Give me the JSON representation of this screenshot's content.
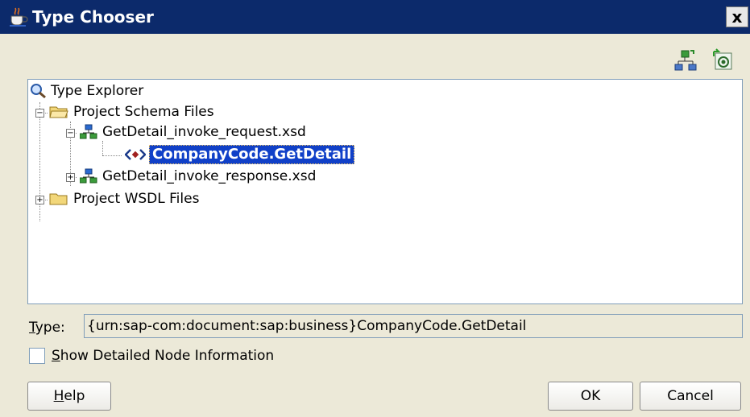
{
  "window": {
    "title": "Type Chooser",
    "close_glyph": "x"
  },
  "toolbar": {
    "icons": [
      "schema-tree-icon",
      "import-schema-icon"
    ]
  },
  "tree": {
    "root": {
      "label": "Type Explorer",
      "icon": "magnifier-icon"
    },
    "schema_folder": {
      "label": "Project Schema Files",
      "icon": "open-folder-icon",
      "expanded": true
    },
    "request_xsd": {
      "label": "GetDetail_invoke_request.xsd",
      "icon": "schema-icon",
      "expanded": true
    },
    "selected_element": {
      "label": "CompanyCode.GetDetail",
      "icon": "element-icon"
    },
    "response_xsd": {
      "label": "GetDetail_invoke_response.xsd",
      "icon": "schema-icon",
      "expanded": false
    },
    "wsdl_folder": {
      "label": "Project WSDL Files",
      "icon": "folder-icon",
      "expanded": false
    }
  },
  "type_field": {
    "label_mnemonic": "T",
    "label_rest": "ype:",
    "value": "{urn:sap-com:document:sap:business}CompanyCode.GetDetail"
  },
  "detail_checkbox": {
    "mnemonic": "S",
    "rest": "how Detailed Node Information",
    "checked": false
  },
  "buttons": {
    "help_mnemonic": "H",
    "help_rest": "elp",
    "ok": "OK",
    "cancel": "Cancel"
  },
  "colors": {
    "titlebar": "#0c2a6b",
    "dialog_bg": "#ece9d8",
    "selection": "#1040c8",
    "border": "#7f9db9"
  }
}
